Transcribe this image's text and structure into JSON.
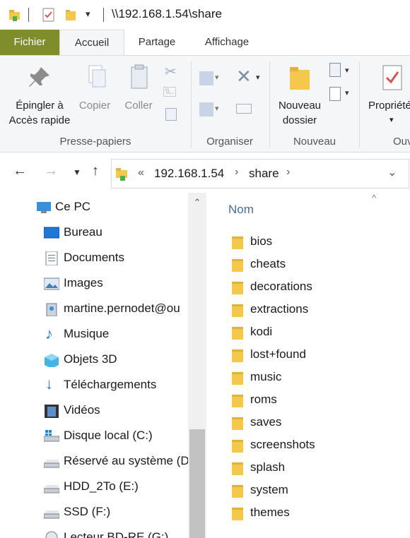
{
  "window": {
    "path": "\\\\192.168.1.54\\share"
  },
  "tabs": {
    "file": "Fichier",
    "home": "Accueil",
    "share": "Partage",
    "view": "Affichage"
  },
  "ribbon": {
    "pin_line1": "Épingler à",
    "pin_line2": "Accès rapide",
    "copy": "Copier",
    "paste": "Coller",
    "new_folder_line1": "Nouveau",
    "new_folder_line2": "dossier",
    "properties": "Propriétés",
    "groups": {
      "clipboard": "Presse-papiers",
      "organize": "Organiser",
      "new": "Nouveau",
      "open": "Ouvrir"
    }
  },
  "address": {
    "overflow": "«",
    "crumbs": [
      "192.168.1.54",
      "share"
    ]
  },
  "nav": {
    "items": [
      {
        "label": "Ce PC",
        "icon": "pc-icon"
      },
      {
        "label": "Bureau",
        "icon": "desktop-icon"
      },
      {
        "label": "Documents",
        "icon": "documents-icon"
      },
      {
        "label": "Images",
        "icon": "pictures-icon"
      },
      {
        "label": "martine.pernodet@ou",
        "icon": "user-folder-icon"
      },
      {
        "label": "Musique",
        "icon": "music-icon"
      },
      {
        "label": "Objets 3D",
        "icon": "3d-objects-icon"
      },
      {
        "label": "Téléchargements",
        "icon": "downloads-icon"
      },
      {
        "label": "Vidéos",
        "icon": "videos-icon"
      },
      {
        "label": "Disque local (C:)",
        "icon": "windows-drive-icon"
      },
      {
        "label": "Réservé au système (D",
        "icon": "drive-icon"
      },
      {
        "label": "HDD_2To (E:)",
        "icon": "drive-icon"
      },
      {
        "label": "SSD (F:)",
        "icon": "drive-icon"
      },
      {
        "label": "Lecteur BD-RE (G:)",
        "icon": "bd-drive-icon"
      }
    ]
  },
  "content": {
    "column_name": "Nom",
    "files": [
      "bios",
      "cheats",
      "decorations",
      "extractions",
      "kodi",
      "lost+found",
      "music",
      "roms",
      "saves",
      "screenshots",
      "splash",
      "system",
      "themes"
    ]
  },
  "colors": {
    "file_tab": "#7f8d2a",
    "folder": "#f4c84a",
    "column_header": "#4a6b9a"
  }
}
